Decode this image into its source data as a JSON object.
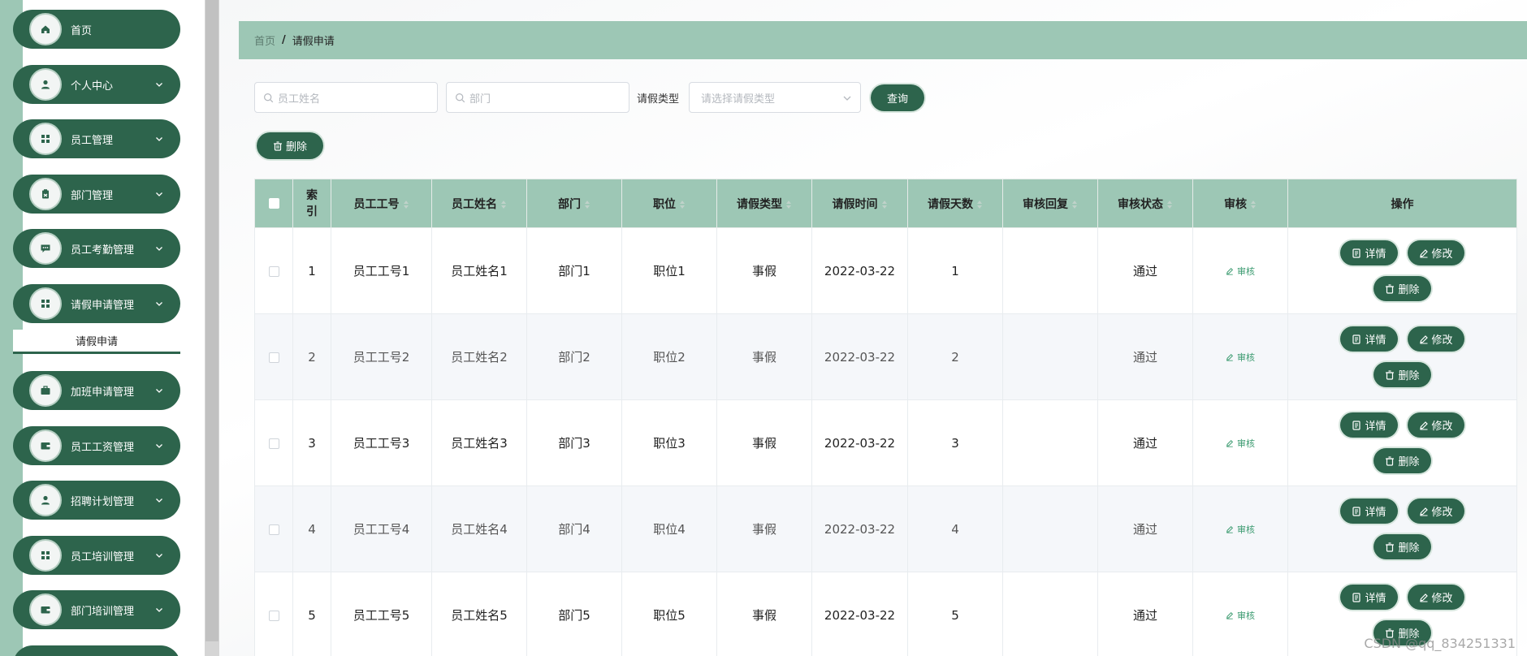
{
  "sidebar": {
    "items": [
      {
        "label": "首页",
        "icon": "home-icon",
        "has_arrow": false
      },
      {
        "label": "个人中心",
        "icon": "user-icon",
        "has_arrow": true
      },
      {
        "label": "员工管理",
        "icon": "grid-icon",
        "has_arrow": true
      },
      {
        "label": "部门管理",
        "icon": "clipboard-icon",
        "has_arrow": true
      },
      {
        "label": "员工考勤管理",
        "icon": "chat-icon",
        "has_arrow": true
      },
      {
        "label": "请假申请管理",
        "icon": "grid-icon",
        "has_arrow": true
      },
      {
        "label": "加班申请管理",
        "icon": "briefcase-icon",
        "has_arrow": true
      },
      {
        "label": "员工工资管理",
        "icon": "wallet-icon",
        "has_arrow": true
      },
      {
        "label": "招聘计划管理",
        "icon": "user-icon",
        "has_arrow": true
      },
      {
        "label": "员工培训管理",
        "icon": "grid-icon",
        "has_arrow": true
      },
      {
        "label": "部门培训管理",
        "icon": "wallet-icon",
        "has_arrow": true
      }
    ],
    "active_submenu": "请假申请"
  },
  "breadcrumb": {
    "home": "首页",
    "separator": "/",
    "current": "请假申请"
  },
  "search": {
    "employee_name_placeholder": "员工姓名",
    "department_placeholder": "部门",
    "leave_type_label": "请假类型",
    "leave_type_placeholder": "请选择请假类型",
    "query_label": "查询"
  },
  "toolbar": {
    "delete_label": "删除"
  },
  "table": {
    "headers": [
      "索引",
      "员工工号",
      "员工姓名",
      "部门",
      "职位",
      "请假类型",
      "请假时间",
      "请假天数",
      "审核回复",
      "审核状态",
      "审核",
      "操作"
    ],
    "rows": [
      {
        "index": "1",
        "emp_no": "员工工号1",
        "emp_name": "员工姓名1",
        "dept": "部门1",
        "position": "职位1",
        "leave_type": "事假",
        "leave_date": "2022-03-22",
        "days": "1",
        "reply": "",
        "status": "通过"
      },
      {
        "index": "2",
        "emp_no": "员工工号2",
        "emp_name": "员工姓名2",
        "dept": "部门2",
        "position": "职位2",
        "leave_type": "事假",
        "leave_date": "2022-03-22",
        "days": "2",
        "reply": "",
        "status": "通过"
      },
      {
        "index": "3",
        "emp_no": "员工工号3",
        "emp_name": "员工姓名3",
        "dept": "部门3",
        "position": "职位3",
        "leave_type": "事假",
        "leave_date": "2022-03-22",
        "days": "3",
        "reply": "",
        "status": "通过"
      },
      {
        "index": "4",
        "emp_no": "员工工号4",
        "emp_name": "员工姓名4",
        "dept": "部门4",
        "position": "职位4",
        "leave_type": "事假",
        "leave_date": "2022-03-22",
        "days": "4",
        "reply": "",
        "status": "通过"
      },
      {
        "index": "5",
        "emp_no": "员工工号5",
        "emp_name": "员工姓名5",
        "dept": "部门5",
        "position": "职位5",
        "leave_type": "事假",
        "leave_date": "2022-03-22",
        "days": "5",
        "reply": "",
        "status": "通过"
      }
    ],
    "audit_label": "审核",
    "detail_label": "详情",
    "edit_label": "修改",
    "row_delete_label": "删除"
  },
  "watermark": "CSDN @qq_834251331",
  "colors": {
    "primary": "#2d644c",
    "header_bg": "#9dc7b5",
    "audit_link": "#3a9a6f"
  }
}
